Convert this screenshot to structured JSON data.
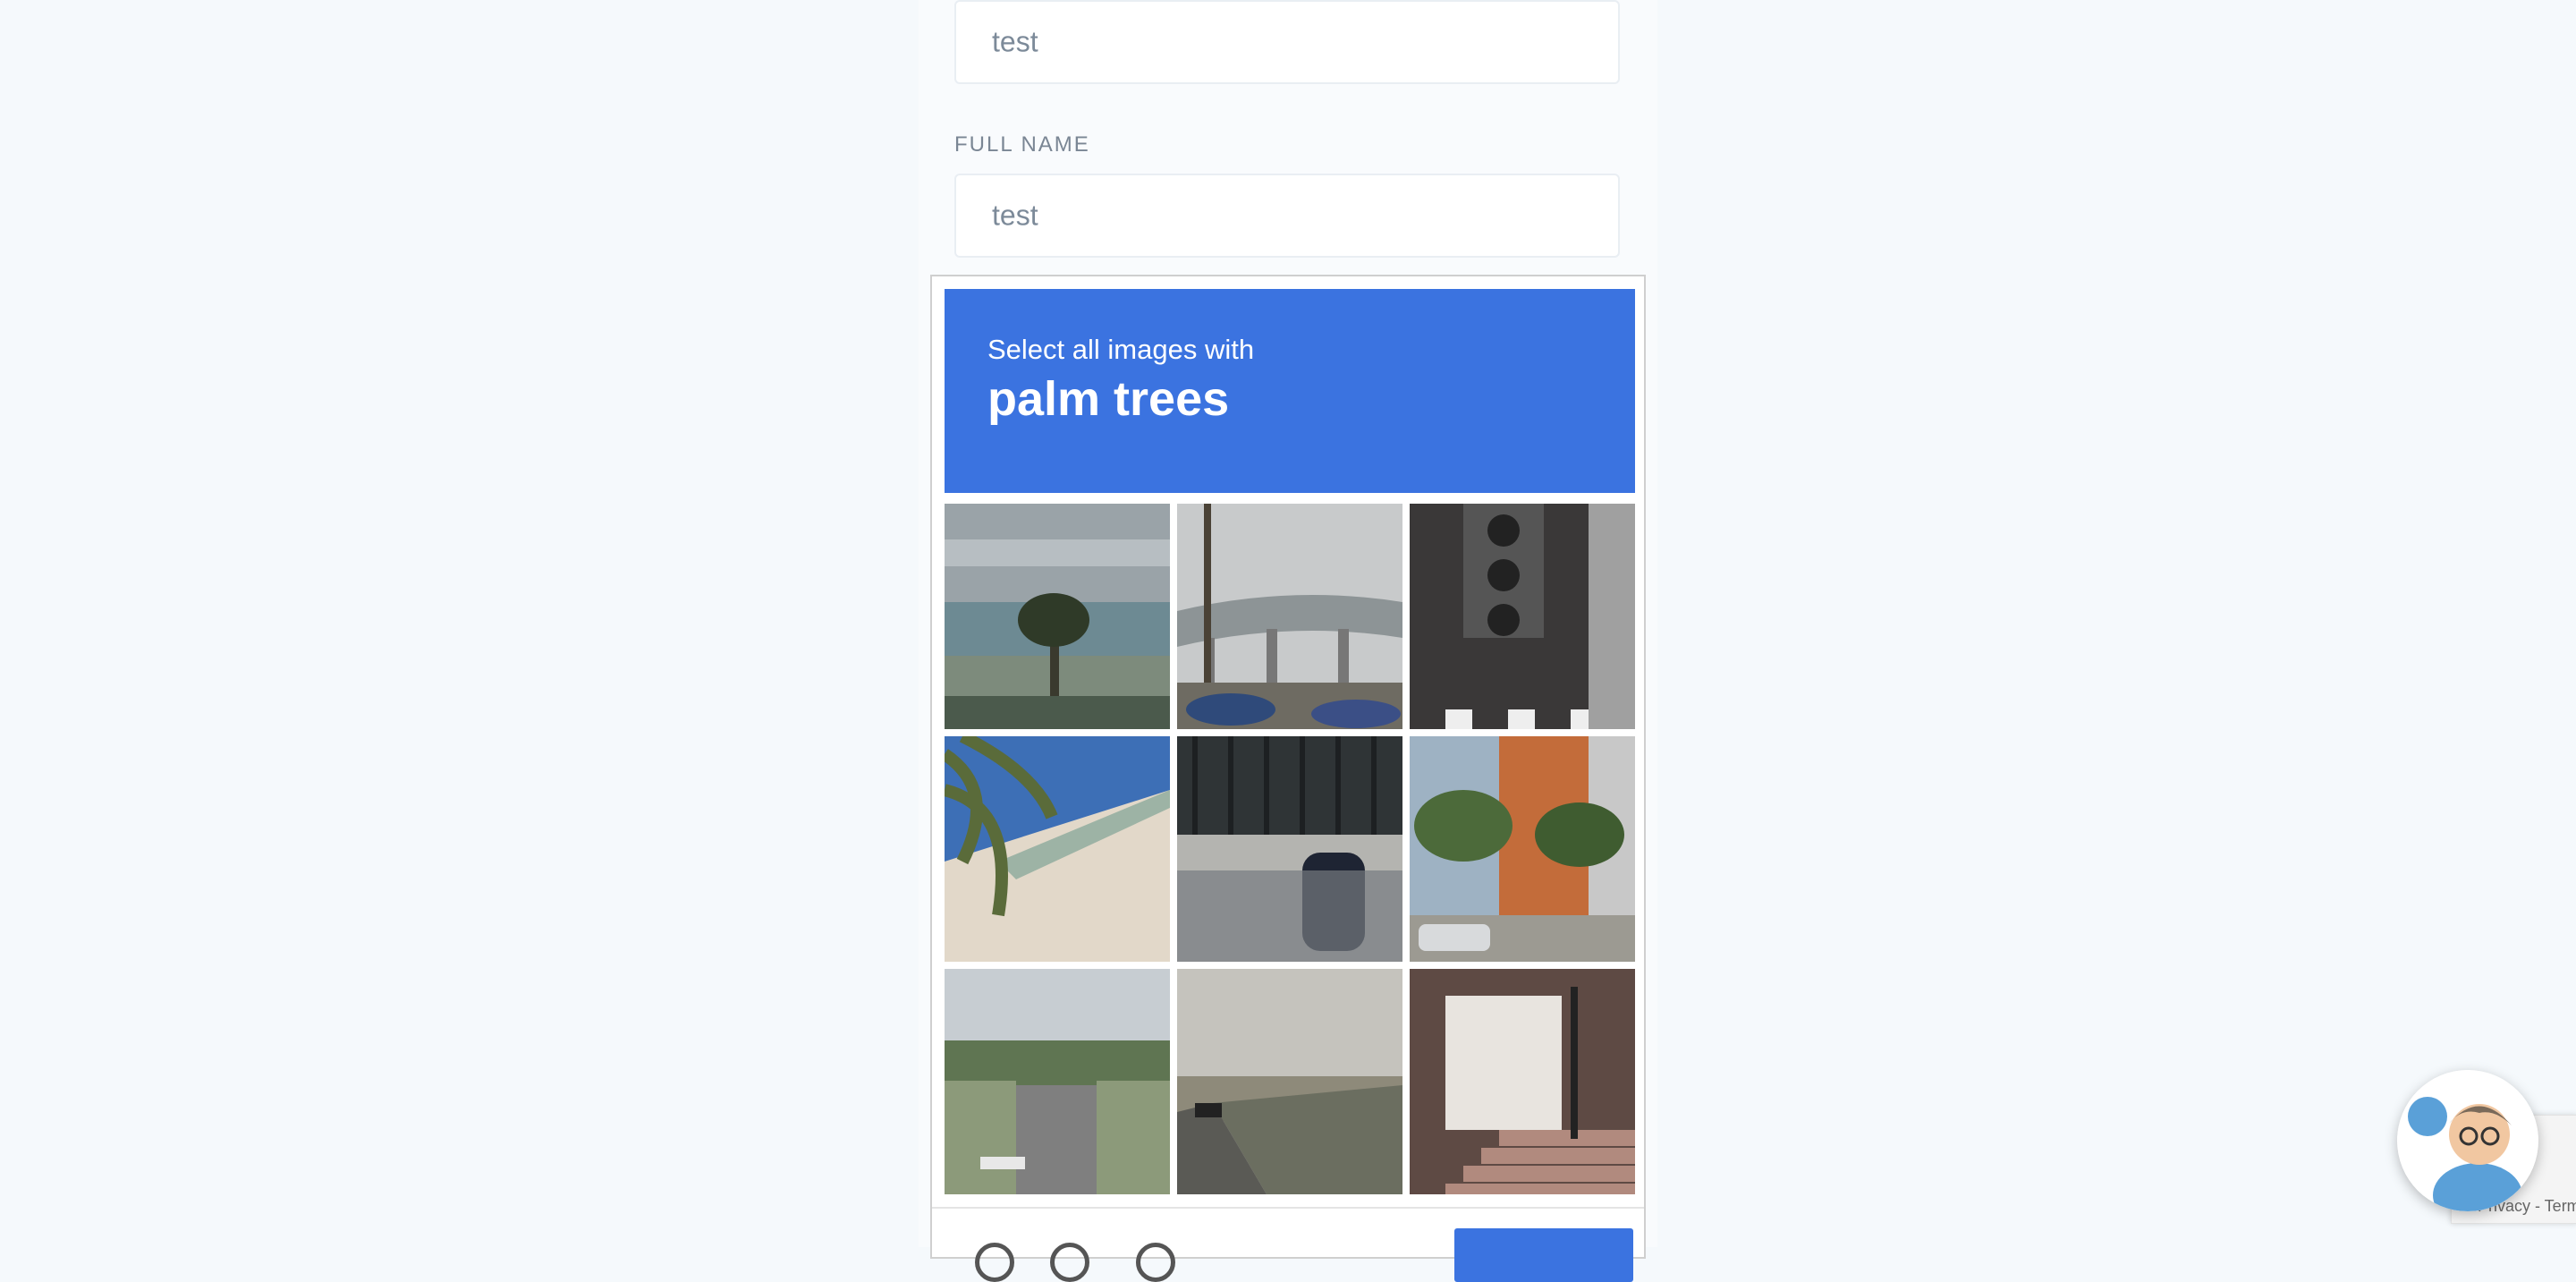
{
  "form": {
    "first_field_value": "test",
    "full_name_label": "FULL NAME",
    "full_name_value": "test"
  },
  "captcha": {
    "instruction": "Select all images with",
    "target": "palm trees",
    "tiles": [
      "palm tree by the bay",
      "freeway overpass",
      "traffic light",
      "palm fronds over building",
      "scooter by fence",
      "palm trees by orange building",
      "tree-lined street",
      "highway sound wall",
      "stairs to doorway"
    ]
  },
  "badge": {
    "terms_text": "Privacy - Terms"
  },
  "colors": {
    "accent": "#3b73e0",
    "page_bg": "#f5f9fc"
  }
}
